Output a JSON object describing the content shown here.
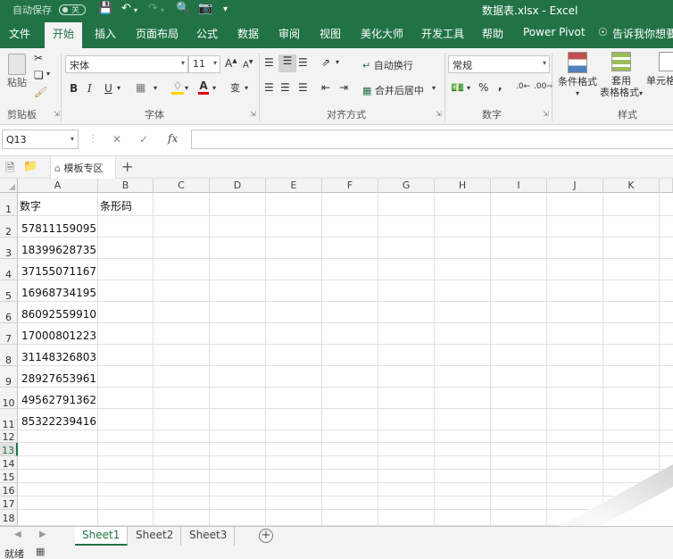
{
  "titlebar": {
    "autosave_label": "自动保存",
    "autosave_state": "关",
    "title": "数据表.xlsx  -  Excel"
  },
  "tabs": [
    "文件",
    "开始",
    "插入",
    "页面布局",
    "公式",
    "数据",
    "审阅",
    "视图",
    "美化大师",
    "开发工具",
    "帮助",
    "Power Pivot",
    "告诉我你想要做"
  ],
  "active_tab": "开始",
  "ribbon": {
    "clipboard": {
      "paste": "粘贴",
      "label": "剪贴板"
    },
    "font": {
      "name": "宋体",
      "size": "11",
      "label": "字体",
      "bold": "B",
      "italic": "I",
      "underline": "U"
    },
    "alignment": {
      "wrap": "自动换行",
      "merge": "合并后居中",
      "label": "对齐方式"
    },
    "number": {
      "format": "常规",
      "label": "数字",
      "percent": "%",
      "comma": ","
    },
    "styles": {
      "conditional": "条件格式",
      "table_line1": "套用",
      "table_line2": "表格格式",
      "cell_line1": "单元格",
      "label": "样式"
    }
  },
  "formula_bar": {
    "name_box": "Q13",
    "fx": "fx",
    "value": ""
  },
  "template_bar": {
    "tab_label": "模板专区"
  },
  "columns": [
    "A",
    "B",
    "C",
    "D",
    "E",
    "F",
    "G",
    "H",
    "I",
    "J",
    "K"
  ],
  "rows": [
    "1",
    "2",
    "3",
    "4",
    "5",
    "6",
    "7",
    "8",
    "9",
    "10",
    "11",
    "12",
    "13",
    "14",
    "15",
    "16",
    "17",
    "18"
  ],
  "selected_row": "13",
  "cells": {
    "A1": "数字",
    "B1": "条形码",
    "A_values": [
      "57811159095",
      "18399628735",
      "37155071167",
      "16968734195",
      "86092559910",
      "17000801223",
      "31148326803",
      "28927653961",
      "49562791362",
      "85322239416"
    ]
  },
  "sheets": [
    "Sheet1",
    "Sheet2",
    "Sheet3"
  ],
  "active_sheet": "Sheet1",
  "status": {
    "text": "就绪"
  },
  "colors": {
    "brand": "#217346",
    "ribbon_bg": "#f3f3f3",
    "grid_line": "#e1e1e1"
  }
}
